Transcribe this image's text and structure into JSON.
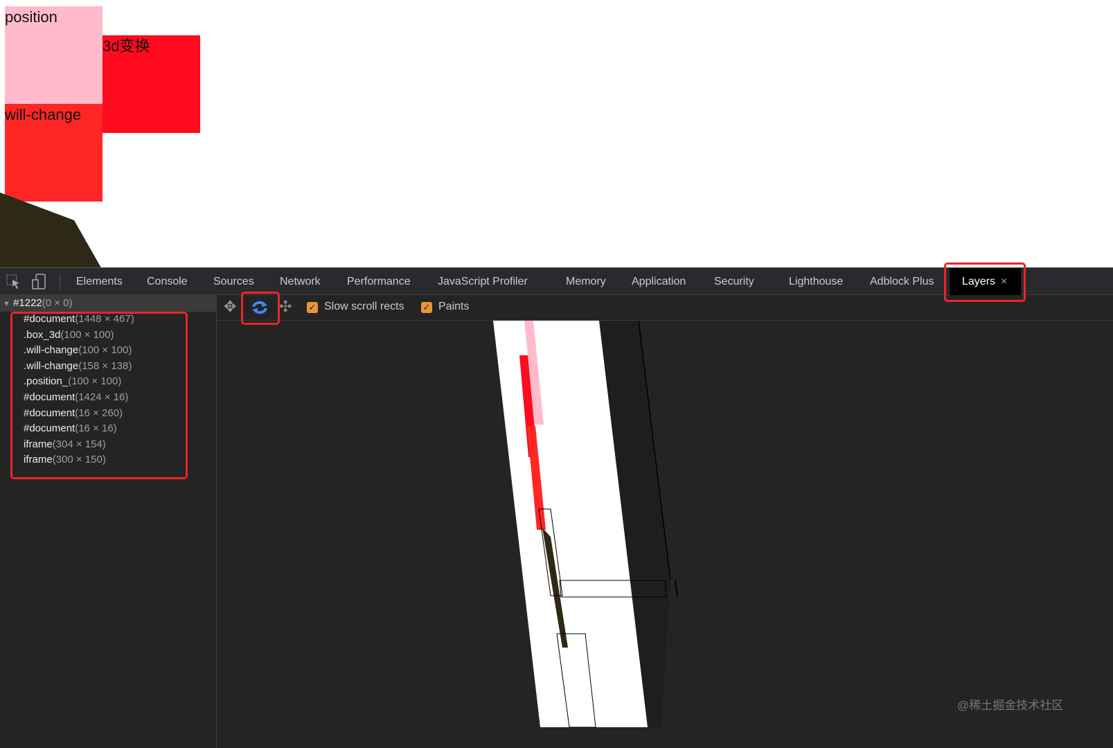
{
  "page": {
    "boxes": [
      {
        "label": "position",
        "color": "#ffbbcb"
      },
      {
        "label": "3d变换",
        "color": "#ff0a1e"
      },
      {
        "label": "will-change",
        "color": "#ff2626"
      }
    ]
  },
  "devtools": {
    "tabs": [
      "Elements",
      "Console",
      "Sources",
      "Network",
      "Performance",
      "JavaScript Profiler",
      "Memory",
      "Application",
      "Security",
      "Lighthouse",
      "Adblock Plus",
      "Layers"
    ],
    "active_tab": "Layers",
    "layers": {
      "root": {
        "name": "#1222",
        "dims": "(0 × 0)"
      },
      "items": [
        {
          "name": "#document",
          "dims": "(1448 × 467)"
        },
        {
          "name": ".box_3d",
          "dims": "(100 × 100)"
        },
        {
          "name": ".will-change",
          "dims": "(100 × 100)"
        },
        {
          "name": ".will-change",
          "dims": "(158 × 138)"
        },
        {
          "name": ".position_",
          "dims": "(100 × 100)"
        },
        {
          "name": "#document",
          "dims": "(1424 × 16)"
        },
        {
          "name": "#document",
          "dims": "(16 × 260)"
        },
        {
          "name": "#document",
          "dims": "(16 × 16)"
        },
        {
          "name": "iframe",
          "dims": "(304 × 154)"
        },
        {
          "name": "iframe",
          "dims": "(300 × 150)"
        }
      ]
    },
    "toolbar": {
      "slow_scroll_rects": "Slow scroll rects",
      "paints": "Paints",
      "slow_checked": true,
      "paints_checked": true
    },
    "watermark": "@稀土掘金技术社区",
    "accent": "#e8262a"
  }
}
